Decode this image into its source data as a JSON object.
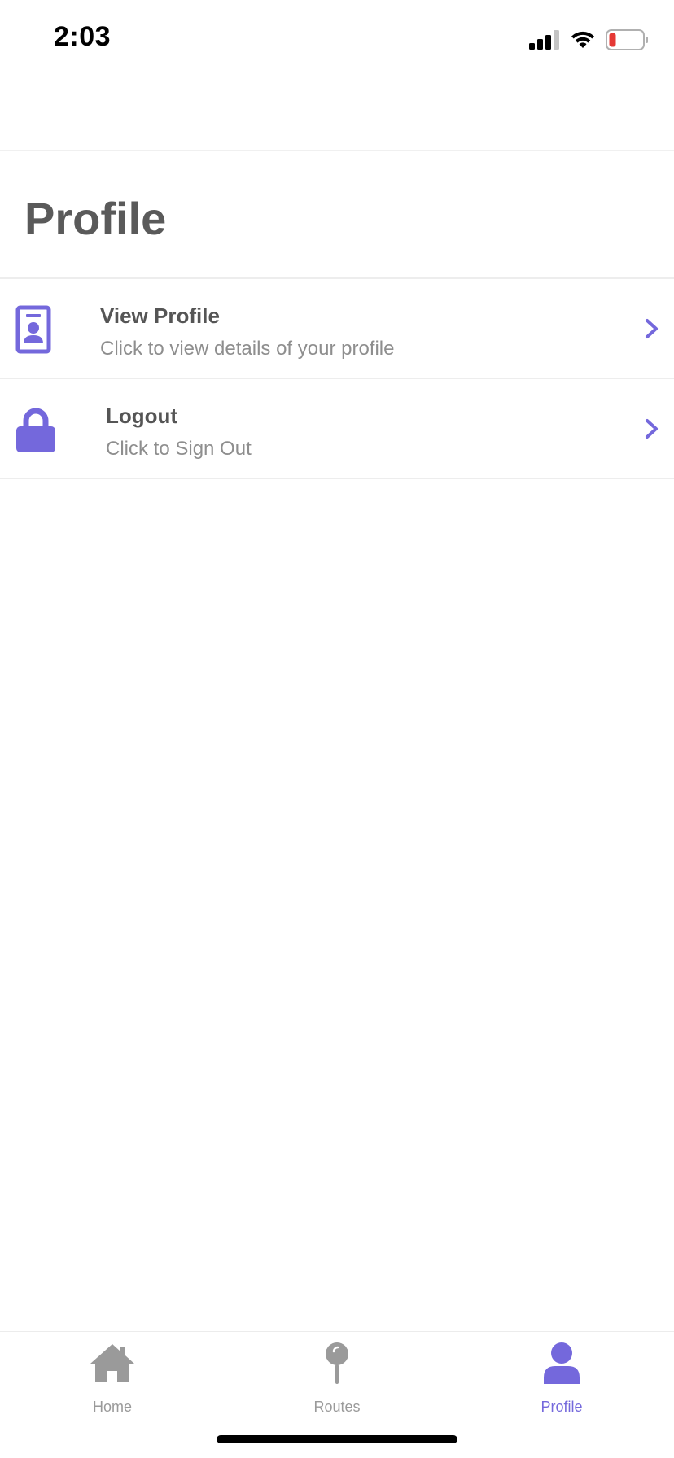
{
  "status_bar": {
    "time": "2:03"
  },
  "header": {
    "title": "Profile"
  },
  "menu": {
    "items": [
      {
        "title": "View Profile",
        "subtitle": "Click to view details of your profile",
        "icon": "id-badge-icon"
      },
      {
        "title": "Logout",
        "subtitle": "Click to Sign Out",
        "icon": "lock-icon"
      }
    ]
  },
  "tab_bar": {
    "tabs": [
      {
        "label": "Home",
        "icon": "home-icon",
        "active": false
      },
      {
        "label": "Routes",
        "icon": "map-pin-icon",
        "active": false
      },
      {
        "label": "Profile",
        "icon": "user-icon",
        "active": true
      }
    ]
  },
  "colors": {
    "accent": "#7468dc",
    "title_text": "#5a5a5a",
    "subtitle_text": "#8e8e8e",
    "inactive_tab": "#9a9a9a",
    "battery_low": "#e53935"
  }
}
